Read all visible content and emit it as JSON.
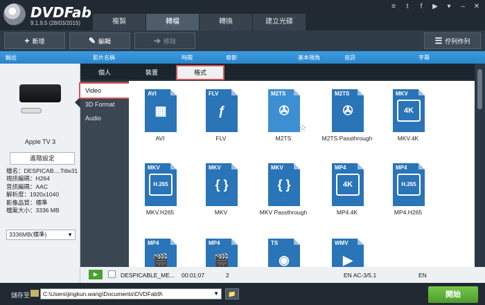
{
  "app": {
    "name": "DVDFab",
    "version": "9.1.9.5 (28/03/2015)"
  },
  "tabs": [
    {
      "label": "複製"
    },
    {
      "label": "轉檔"
    },
    {
      "label": "轉換"
    },
    {
      "label": "建立光碟"
    }
  ],
  "toolbar": {
    "add_label": "新增",
    "edit_label": "編輯",
    "disabled_label": "移除",
    "queue_label": "佇列作列"
  },
  "columns": {
    "output": "輸出",
    "source": "影片名稱",
    "time": "時間",
    "chapter": "章節",
    "aspect": "基本視角",
    "audio": "音訊",
    "subtitle": "字幕"
  },
  "left_panel": {
    "device_name": "Apple TV 3",
    "advanced_button": "進階設定",
    "specs": [
      "檔名：DESPICAB....Title31",
      "視訊編碼：H264",
      "音訊編碼：AAC",
      "解析度：1920x1040",
      "影像品質：標準",
      "檔案大小：3336 MB"
    ],
    "size_select": "3336MB(標準)"
  },
  "dialog": {
    "tabs": [
      "個人",
      "裝置",
      "格式"
    ],
    "subnav": [
      "Video",
      "3D Format",
      "Audio"
    ],
    "formats": [
      {
        "badge": "AVI",
        "glyph": "film",
        "label": "AVI"
      },
      {
        "badge": "FLV",
        "glyph": "flash",
        "label": "FLV"
      },
      {
        "badge": "M2TS",
        "glyph": "reel",
        "label": "M2TS"
      },
      {
        "badge": "M2TS",
        "glyph": "reel",
        "label": "M2TS Passthrough"
      },
      {
        "badge": "MKV",
        "glyph": "4K",
        "label": "MKV.4K"
      },
      {
        "badge": "MKV",
        "glyph": "H.265 HEVC",
        "label": "MKV.H265"
      },
      {
        "badge": "MKV",
        "glyph": "{ }",
        "label": "MKV"
      },
      {
        "badge": "MKV",
        "glyph": "{ }",
        "label": "MKV Passthrough"
      },
      {
        "badge": "MP4",
        "glyph": "4K",
        "label": "MP4.4K"
      },
      {
        "badge": "MP4",
        "glyph": "H.265 HEVC",
        "label": "MP4.H265"
      },
      {
        "badge": "MP4",
        "glyph": "clapper",
        "label": ""
      },
      {
        "badge": "MP4",
        "glyph": "clapper",
        "label": ""
      },
      {
        "badge": "TS",
        "glyph": "camera",
        "label": ""
      },
      {
        "badge": "WMV",
        "glyph": "play",
        "label": ""
      }
    ]
  },
  "job": {
    "name": "DESPICABLE_ME...",
    "time": "00:01:07",
    "chapter": "2",
    "audio": "EN AC-3/5.1",
    "subtitle": "EN"
  },
  "bottom": {
    "saveto_label": "儲存至",
    "path": "C:\\Users\\jingkun.wang\\Documents\\DVDFab9\\",
    "start_label": "開始"
  }
}
